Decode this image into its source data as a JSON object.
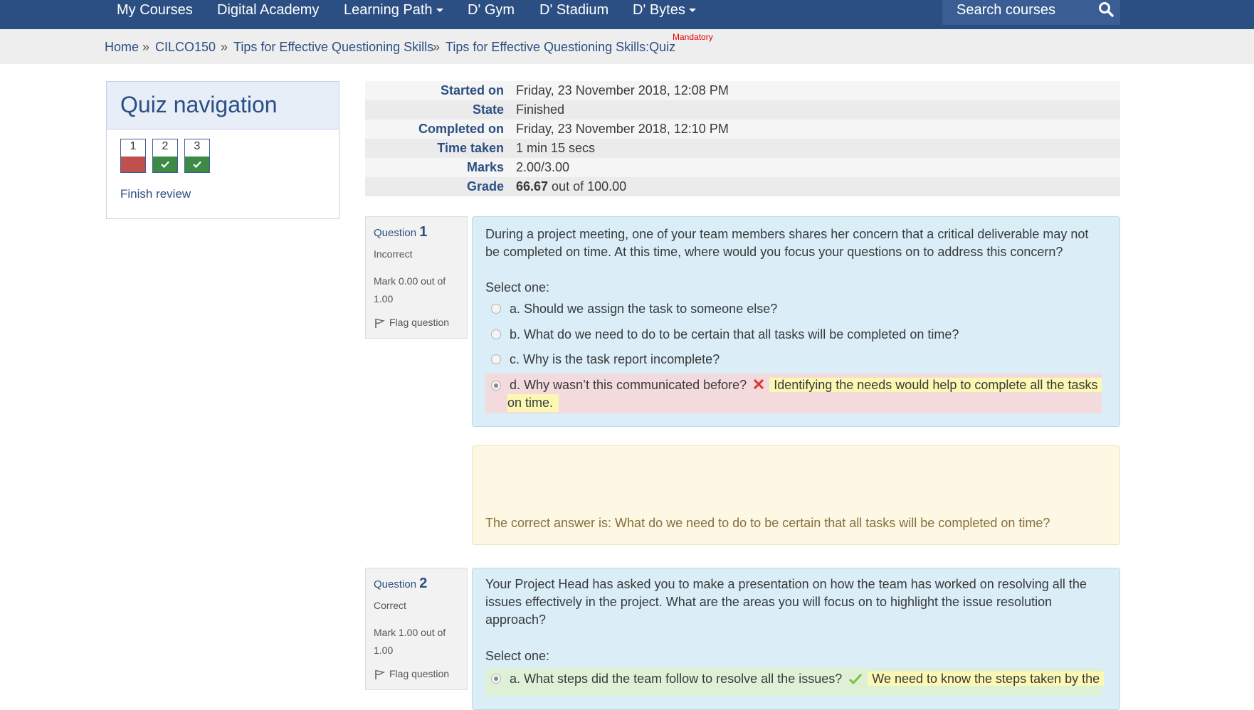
{
  "nav": {
    "items": [
      {
        "label": "My Courses",
        "dropdown": false
      },
      {
        "label": "Digital Academy",
        "dropdown": false
      },
      {
        "label": "Learning Path",
        "dropdown": true
      },
      {
        "label": "D' Gym",
        "dropdown": false
      },
      {
        "label": "D' Stadium",
        "dropdown": false
      },
      {
        "label": "D' Bytes",
        "dropdown": true
      }
    ],
    "search_placeholder": "Search courses",
    "search_icon": "magnifier"
  },
  "breadcrumb": {
    "items": [
      "Home",
      "CILCO150",
      "Tips for Effective Questioning Skills",
      "Tips for Effective Questioning Skills:Quiz"
    ],
    "separator": "»",
    "badge": "Mandatory"
  },
  "quiz_nav": {
    "title": "Quiz navigation",
    "buttons": [
      {
        "number": "1",
        "status": "incorrect"
      },
      {
        "number": "2",
        "status": "correct"
      },
      {
        "number": "3",
        "status": "correct"
      }
    ],
    "finish_review": "Finish review"
  },
  "summary": {
    "rows": [
      {
        "label": "Started on",
        "value": "Friday, 23 November 2018, 12:08 PM"
      },
      {
        "label": "State",
        "value": "Finished"
      },
      {
        "label": "Completed on",
        "value": "Friday, 23 November 2018, 12:10 PM"
      },
      {
        "label": "Time taken",
        "value": "1 min 15 secs"
      },
      {
        "label": "Marks",
        "value": "2.00/3.00"
      },
      {
        "label": "Grade",
        "value_bold": "66.67",
        "value_rest": " out of 100.00"
      }
    ]
  },
  "questions": [
    {
      "prefix": "Question",
      "number": "1",
      "state": "Incorrect",
      "mark": "Mark 0.00 out of 1.00",
      "flag": "Flag question",
      "text": "During a project meeting, one of your team members shares her concern that a critical deliverable may not be completed on time. At this time, where would you focus your questions on to address this concern?",
      "select_one": "Select one:",
      "options": [
        {
          "label": "a. Should we assign the task to someone else?",
          "checked": false
        },
        {
          "label": "b. What do we need to do to be certain that all tasks will be completed on time?",
          "checked": false
        },
        {
          "label": "c. Why is the task report incomplete?",
          "checked": false
        },
        {
          "label": "d. Why wasn’t this communicated before?",
          "checked": true,
          "result_icon": "cross-icon",
          "feedback_line1": "Identifying the needs would help to complete all the tasks",
          "feedback_line2": "on time."
        }
      ],
      "right_answer": "The correct answer is: What do we need to do to be certain that all tasks will be completed on time?"
    },
    {
      "prefix": "Question",
      "number": "2",
      "state": "Correct",
      "mark": "Mark 1.00 out of 1.00",
      "flag": "Flag question",
      "text": "Your Project Head has asked you to make a presentation on how the team has worked on resolving all the issues effectively in the project. What are the areas you will focus on to highlight the issue resolution approach?",
      "select_one": "Select one:",
      "options": [
        {
          "label": "a. What steps did the team follow to resolve all the issues?",
          "checked": true,
          "result_icon": "check-icon",
          "feedback_line1": "We need to know the steps taken by the"
        }
      ]
    }
  ],
  "colors": {
    "nav_bg": "#2c4f83",
    "link": "#2c4f83",
    "incorrect": "#c0504d",
    "correct": "#3d8a47",
    "question_bg": "#dbedf6",
    "feedback_bg": "#fcf8e3",
    "mandatory": "#e00000"
  }
}
